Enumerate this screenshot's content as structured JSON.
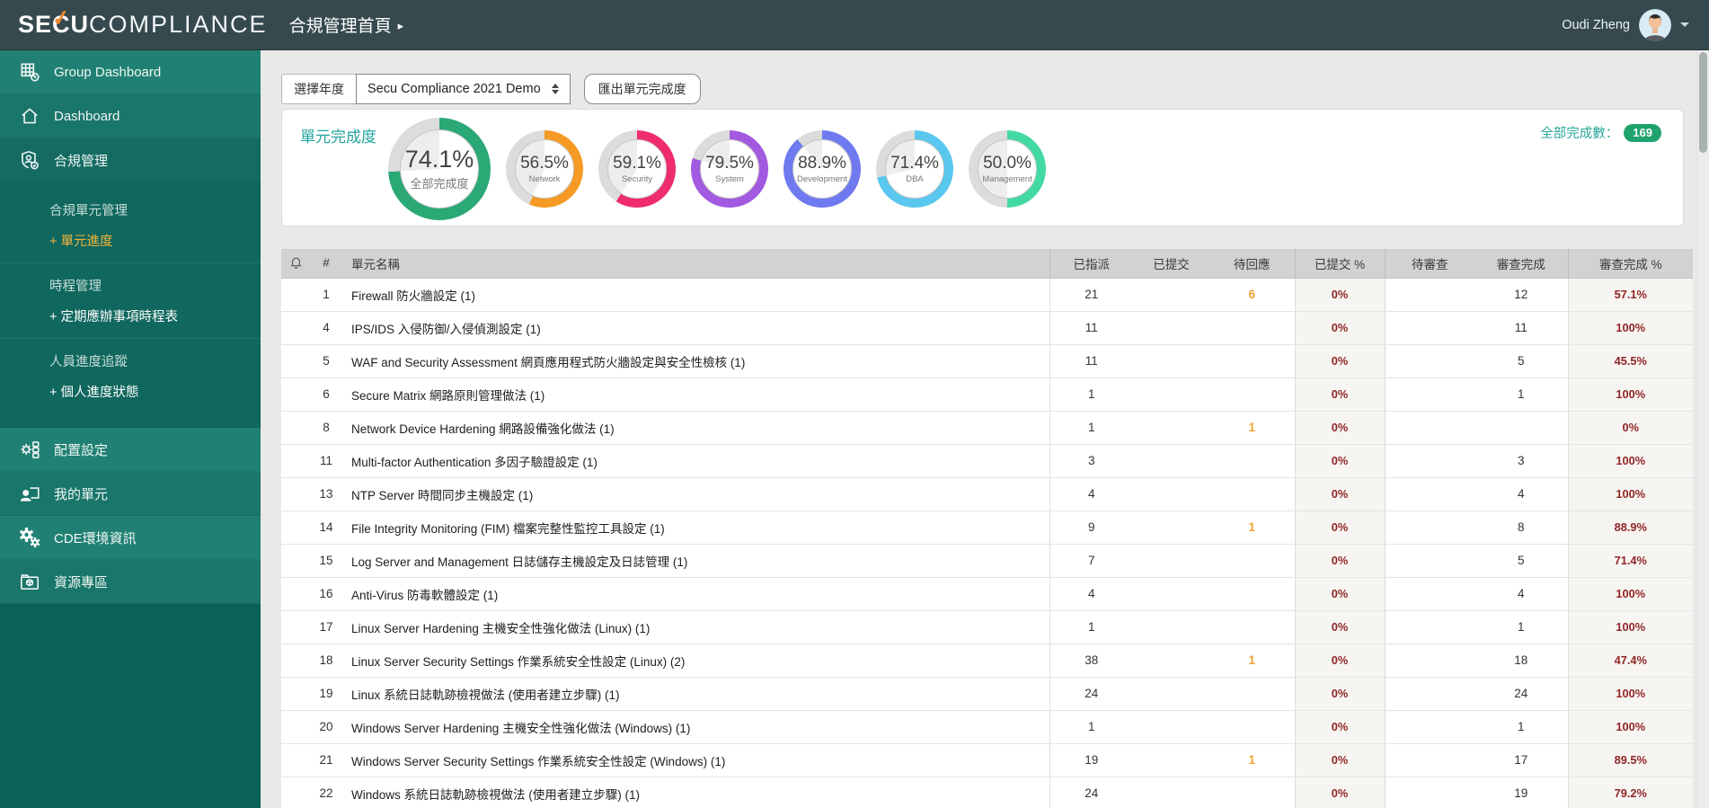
{
  "header": {
    "logo_se": "SE",
    "logo_c": "C",
    "logo_u": "U",
    "logo_compliance": "COMPLIANCE",
    "page_title": "合規管理首頁",
    "user_name": "Oudi Zheng"
  },
  "sidebar": {
    "items": [
      {
        "type": "link",
        "name": "group-dashboard",
        "icon": "grid-dashboard-icon",
        "label": "Group Dashboard",
        "alt": true
      },
      {
        "type": "link",
        "name": "dashboard",
        "icon": "home-icon",
        "label": "Dashboard",
        "alt": false
      },
      {
        "type": "parent",
        "name": "compliance-management",
        "icon": "shield-user-icon",
        "label": "合規管理",
        "submenu": [
          {
            "type": "group",
            "label": "合規單元管理"
          },
          {
            "type": "sublink",
            "label": "+ 單元進度",
            "active": true
          },
          {
            "type": "divider"
          },
          {
            "type": "group",
            "label": "時程管理"
          },
          {
            "type": "sublink",
            "label": "+ 定期應辦事項時程表",
            "active": false
          },
          {
            "type": "divider"
          },
          {
            "type": "group",
            "label": "人員進度追蹤"
          },
          {
            "type": "sublink",
            "label": "+ 個人進度狀態",
            "active": false
          }
        ]
      },
      {
        "type": "link",
        "name": "config-settings",
        "icon": "config-icon",
        "label": "配置設定",
        "alt": true
      },
      {
        "type": "link",
        "name": "my-units",
        "icon": "my-unit-icon",
        "label": "我的單元",
        "alt": false
      },
      {
        "type": "link",
        "name": "cde-environment",
        "icon": "gears-icon",
        "label": "CDE環境資訊",
        "alt": true
      },
      {
        "type": "link",
        "name": "resource-area",
        "icon": "folder-box-icon",
        "label": "資源專區",
        "alt": false
      }
    ]
  },
  "toolbar": {
    "year_label": "選擇年度",
    "year_value": "Secu Compliance 2021 Demo",
    "export_button": "匯出單元完成度"
  },
  "completion": {
    "title": "單元完成度",
    "total_label": "全部完成數：",
    "total_count": "169"
  },
  "chart_data": {
    "type": "donut-set",
    "title": "單元完成度",
    "donuts": [
      {
        "value": 74.1,
        "display": "74.1%",
        "label": "全部完成度",
        "color": "#2aa876",
        "size": "large"
      },
      {
        "value": 56.5,
        "display": "56.5%",
        "label": "Network",
        "color": "#f59a23",
        "size": "small"
      },
      {
        "value": 59.1,
        "display": "59.1%",
        "label": "Security",
        "color": "#ee2c6e",
        "size": "small"
      },
      {
        "value": 79.5,
        "display": "79.5%",
        "label": "System",
        "color": "#a25ae0",
        "size": "small"
      },
      {
        "value": 88.9,
        "display": "88.9%",
        "label": "Development",
        "color": "#6f79f0",
        "size": "small"
      },
      {
        "value": 71.4,
        "display": "71.4%",
        "label": "DBA",
        "color": "#59c7ee",
        "size": "small"
      },
      {
        "value": 50.0,
        "display": "50.0%",
        "label": "Management",
        "color": "#43d9a3",
        "size": "small"
      }
    ],
    "remainder_color": "#dcdcdc"
  },
  "table": {
    "headers": {
      "num": "#",
      "name": "單元名稱",
      "assigned": "已指派",
      "submitted": "已提交",
      "pending_response": "待回應",
      "submitted_pct": "已提交 %",
      "pending_review": "待審查",
      "review_done": "審查完成",
      "review_pct": "審查完成 %"
    },
    "rows": [
      {
        "num": "1",
        "name": "Firewall 防火牆設定 (1)",
        "assigned": "21",
        "submitted": "",
        "pending_response": "6",
        "submitted_pct": "0%",
        "pending_review": "",
        "review_done": "12",
        "review_pct": "57.1%"
      },
      {
        "num": "4",
        "name": "IPS/IDS 入侵防御/入侵偵測設定 (1)",
        "assigned": "11",
        "submitted": "",
        "pending_response": "",
        "submitted_pct": "0%",
        "pending_review": "",
        "review_done": "11",
        "review_pct": "100%"
      },
      {
        "num": "5",
        "name": "WAF and Security Assessment 網頁應用程式防火牆設定與安全性檢核 (1)",
        "assigned": "11",
        "submitted": "",
        "pending_response": "",
        "submitted_pct": "0%",
        "pending_review": "",
        "review_done": "5",
        "review_pct": "45.5%"
      },
      {
        "num": "6",
        "name": "Secure Matrix 網路原則管理做法 (1)",
        "assigned": "1",
        "submitted": "",
        "pending_response": "",
        "submitted_pct": "0%",
        "pending_review": "",
        "review_done": "1",
        "review_pct": "100%"
      },
      {
        "num": "8",
        "name": "Network Device Hardening 網路設備強化做法 (1)",
        "assigned": "1",
        "submitted": "",
        "pending_response": "1",
        "submitted_pct": "0%",
        "pending_review": "",
        "review_done": "",
        "review_pct": "0%"
      },
      {
        "num": "11",
        "name": "Multi-factor Authentication 多因子驗證設定 (1)",
        "assigned": "3",
        "submitted": "",
        "pending_response": "",
        "submitted_pct": "0%",
        "pending_review": "",
        "review_done": "3",
        "review_pct": "100%"
      },
      {
        "num": "13",
        "name": "NTP Server 時間同步主機設定 (1)",
        "assigned": "4",
        "submitted": "",
        "pending_response": "",
        "submitted_pct": "0%",
        "pending_review": "",
        "review_done": "4",
        "review_pct": "100%"
      },
      {
        "num": "14",
        "name": "File Integrity Monitoring (FIM) 檔案完整性監控工具設定 (1)",
        "assigned": "9",
        "submitted": "",
        "pending_response": "1",
        "submitted_pct": "0%",
        "pending_review": "",
        "review_done": "8",
        "review_pct": "88.9%"
      },
      {
        "num": "15",
        "name": "Log Server and Management 日誌儲存主機設定及日誌管理 (1)",
        "assigned": "7",
        "submitted": "",
        "pending_response": "",
        "submitted_pct": "0%",
        "pending_review": "",
        "review_done": "5",
        "review_pct": "71.4%"
      },
      {
        "num": "16",
        "name": "Anti-Virus 防毒軟體設定 (1)",
        "assigned": "4",
        "submitted": "",
        "pending_response": "",
        "submitted_pct": "0%",
        "pending_review": "",
        "review_done": "4",
        "review_pct": "100%"
      },
      {
        "num": "17",
        "name": "Linux Server Hardening 主機安全性強化做法 (Linux) (1)",
        "assigned": "1",
        "submitted": "",
        "pending_response": "",
        "submitted_pct": "0%",
        "pending_review": "",
        "review_done": "1",
        "review_pct": "100%"
      },
      {
        "num": "18",
        "name": "Linux Server Security Settings 作業系統安全性設定 (Linux) (2)",
        "assigned": "38",
        "submitted": "",
        "pending_response": "1",
        "submitted_pct": "0%",
        "pending_review": "",
        "review_done": "18",
        "review_pct": "47.4%"
      },
      {
        "num": "19",
        "name": "Linux 系統日誌軌跡檢視做法 (使用者建立步驟) (1)",
        "assigned": "24",
        "submitted": "",
        "pending_response": "",
        "submitted_pct": "0%",
        "pending_review": "",
        "review_done": "24",
        "review_pct": "100%"
      },
      {
        "num": "20",
        "name": "Windows Server Hardening 主機安全性強化做法 (Windows) (1)",
        "assigned": "1",
        "submitted": "",
        "pending_response": "",
        "submitted_pct": "0%",
        "pending_review": "",
        "review_done": "1",
        "review_pct": "100%"
      },
      {
        "num": "21",
        "name": "Windows Server Security Settings 作業系統安全性設定 (Windows) (1)",
        "assigned": "19",
        "submitted": "",
        "pending_response": "1",
        "submitted_pct": "0%",
        "pending_review": "",
        "review_done": "17",
        "review_pct": "89.5%"
      },
      {
        "num": "22",
        "name": "Windows 系統日誌軌跡檢視做法 (使用者建立步驟) (1)",
        "assigned": "24",
        "submitted": "",
        "pending_response": "",
        "submitted_pct": "0%",
        "pending_review": "",
        "review_done": "19",
        "review_pct": "79.2%"
      }
    ]
  }
}
